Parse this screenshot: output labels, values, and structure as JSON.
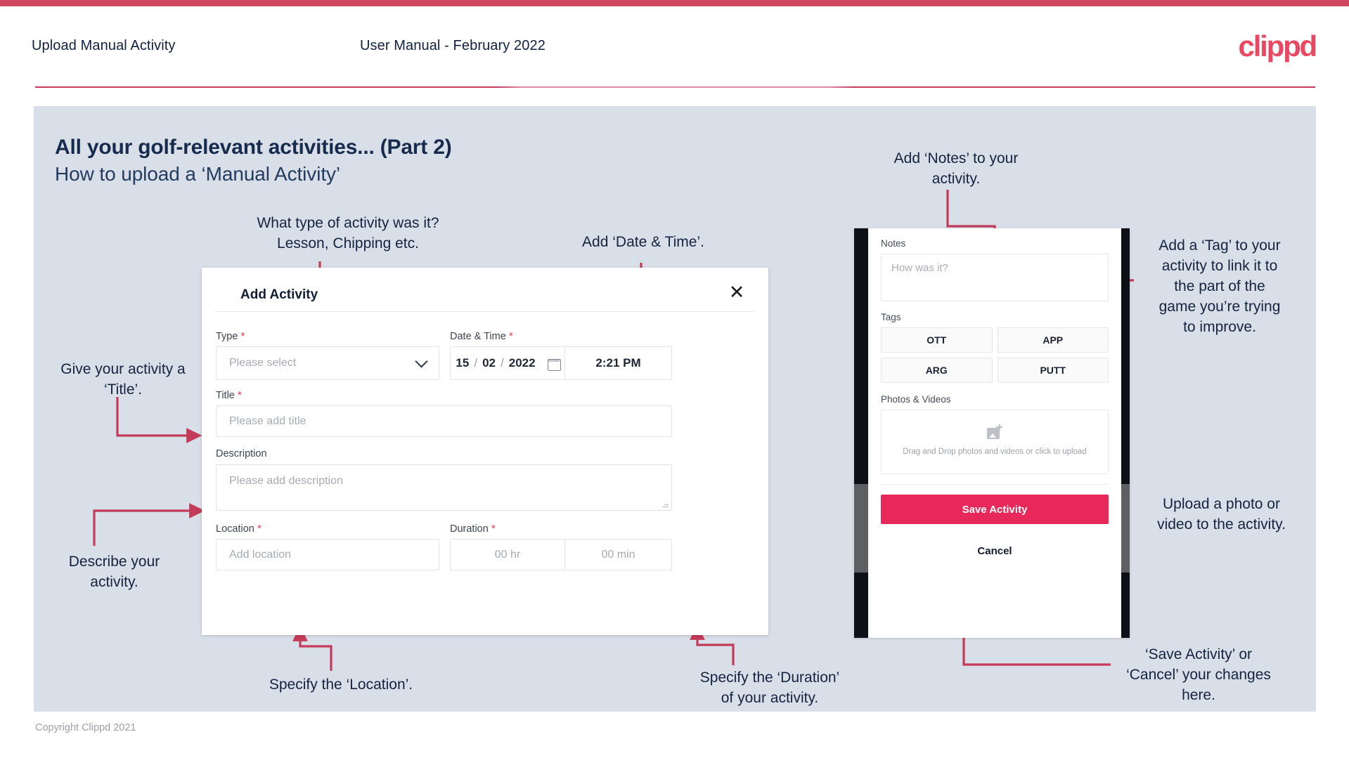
{
  "header": {
    "title": "Upload Manual Activity",
    "subtitle": "User Manual - February 2022",
    "logo": "clippd"
  },
  "slide": {
    "title": "All your golf-relevant activities... (Part 2)",
    "subtitle": "How to upload a ‘Manual Activity’"
  },
  "annotations": {
    "type": "What type of activity was it?\nLesson, Chipping etc.",
    "date_time": "Add ‘Date & Time’.",
    "title": "Give your activity a\n‘Title’.",
    "describe": "Describe your\nactivity.",
    "location": "Specify the ‘Location’.",
    "duration": "Specify the ‘Duration’\nof your activity.",
    "notes": "Add ‘Notes’ to your\nactivity.",
    "tags": "Add a ‘Tag’ to your\nactivity to link it to\nthe part of the\ngame you’re trying\nto improve.",
    "upload": "Upload a photo or\nvideo to the activity.",
    "save_cancel": "‘Save Activity’ or\n‘Cancel’ your changes\nhere."
  },
  "dialog": {
    "title": "Add Activity",
    "close_icon": "close-icon",
    "fields": {
      "type": {
        "label": "Type",
        "required": true,
        "placeholder": "Please select"
      },
      "date_time": {
        "label": "Date & Time",
        "required": true,
        "day": "15",
        "month": "02",
        "year": "2022",
        "time": "2:21 PM"
      },
      "title": {
        "label": "Title",
        "required": true,
        "placeholder": "Please add title"
      },
      "description": {
        "label": "Description",
        "required": false,
        "placeholder": "Please add description"
      },
      "location": {
        "label": "Location",
        "required": true,
        "placeholder": "Add location"
      },
      "duration": {
        "label": "Duration",
        "required": true,
        "hours": "00 hr",
        "minutes": "00 min"
      }
    }
  },
  "phone": {
    "notes_label": "Notes",
    "notes_placeholder": "How was it?",
    "tags_label": "Tags",
    "tags": [
      "OTT",
      "APP",
      "ARG",
      "PUTT"
    ],
    "photos_label": "Photos & Videos",
    "dropzone_text": "Drag and Drop photos and videos or click to upload",
    "save_label": "Save Activity",
    "cancel_label": "Cancel"
  },
  "footer": {
    "copyright": "Copyright Clippd 2021"
  },
  "colors": {
    "brand_crimson": "#ea4862",
    "accent_rule": "#c6395a",
    "slide_bg": "#d9dfe8",
    "text_dark": "#15233f",
    "save_button": "#e8275a",
    "required_star": "#e8394f"
  }
}
